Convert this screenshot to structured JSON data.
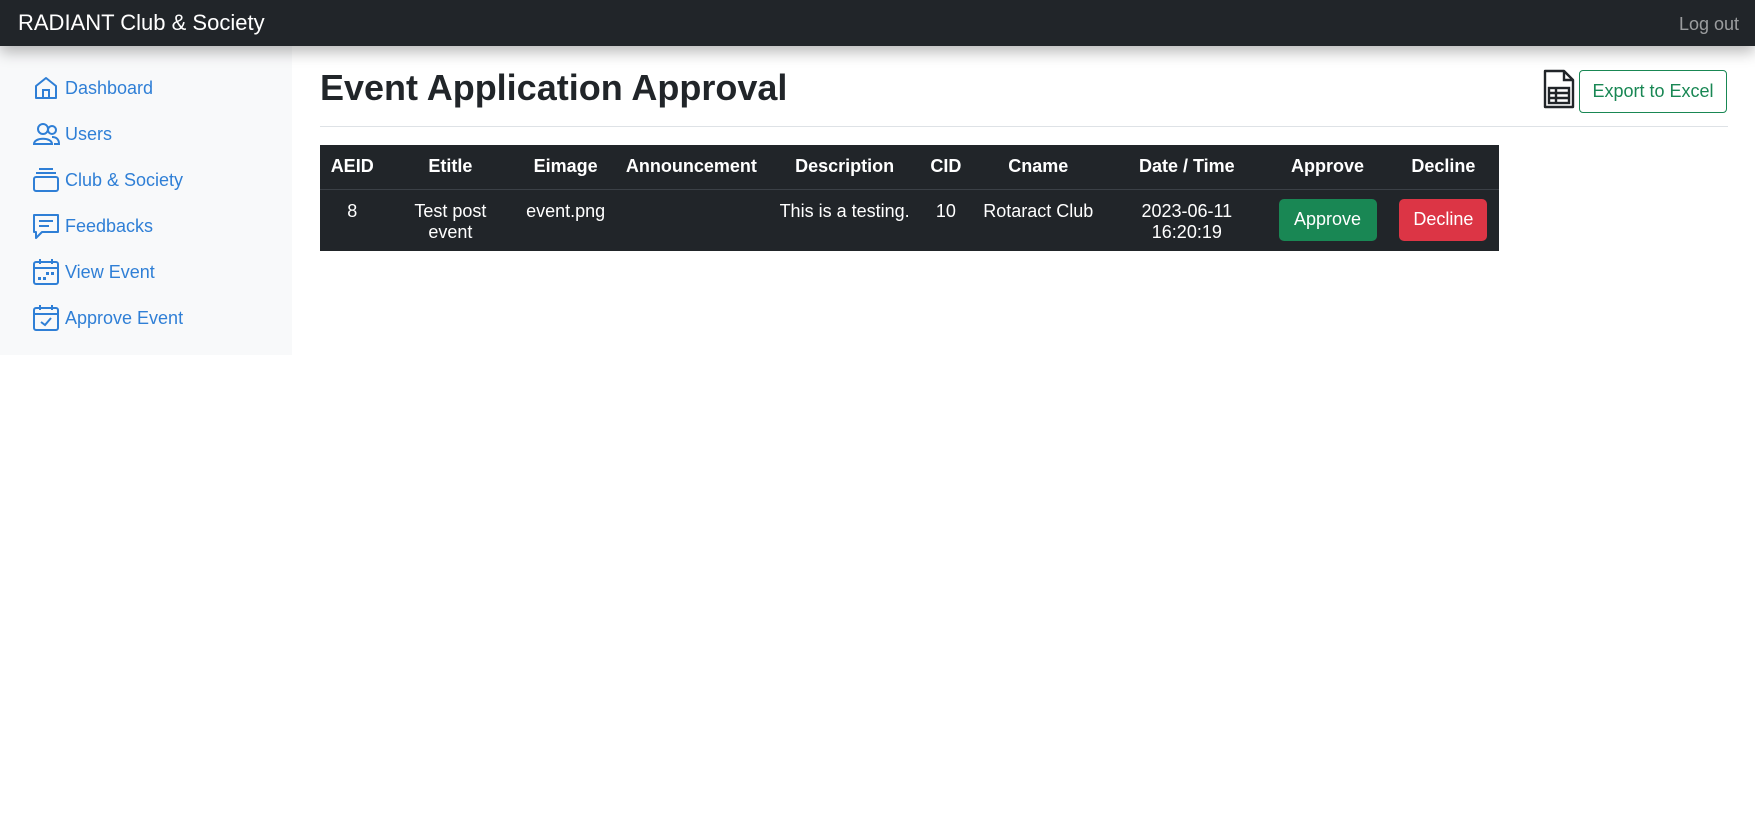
{
  "navbar": {
    "brand": "RADIANT Club & Society",
    "logout_label": "Log out"
  },
  "sidebar": {
    "items": [
      {
        "label": "Dashboard",
        "icon": "house-icon"
      },
      {
        "label": "Users",
        "icon": "people-icon"
      },
      {
        "label": "Club & Society",
        "icon": "collection-icon"
      },
      {
        "label": "Feedbacks",
        "icon": "chat-text-icon"
      },
      {
        "label": "View Event",
        "icon": "calendar-icon"
      },
      {
        "label": "Approve Event",
        "icon": "calendar-check-icon"
      }
    ]
  },
  "main": {
    "title": "Event Application Approval",
    "export_label": "Export to Excel",
    "export_icon": "file-spreadsheet-icon"
  },
  "table": {
    "headers": [
      "AEID",
      "Etitle",
      "Eimage",
      "Announcement",
      "Description",
      "CID",
      "Cname",
      "Date / Time",
      "Approve",
      "Decline"
    ],
    "rows": [
      {
        "aeid": "8",
        "etitle": "Test post event",
        "eimage": "event.png",
        "announcement": "",
        "description": "This is a testing.",
        "cid": "10",
        "cname": "Rotaract Club",
        "datetime": "2023-06-11 16:20:19",
        "approve_label": "Approve",
        "decline_label": "Decline"
      }
    ]
  },
  "colors": {
    "navbar_bg": "#212529",
    "link": "#2f7fd6",
    "approve": "#198754",
    "decline": "#dc3545",
    "export_outline": "#198754"
  }
}
